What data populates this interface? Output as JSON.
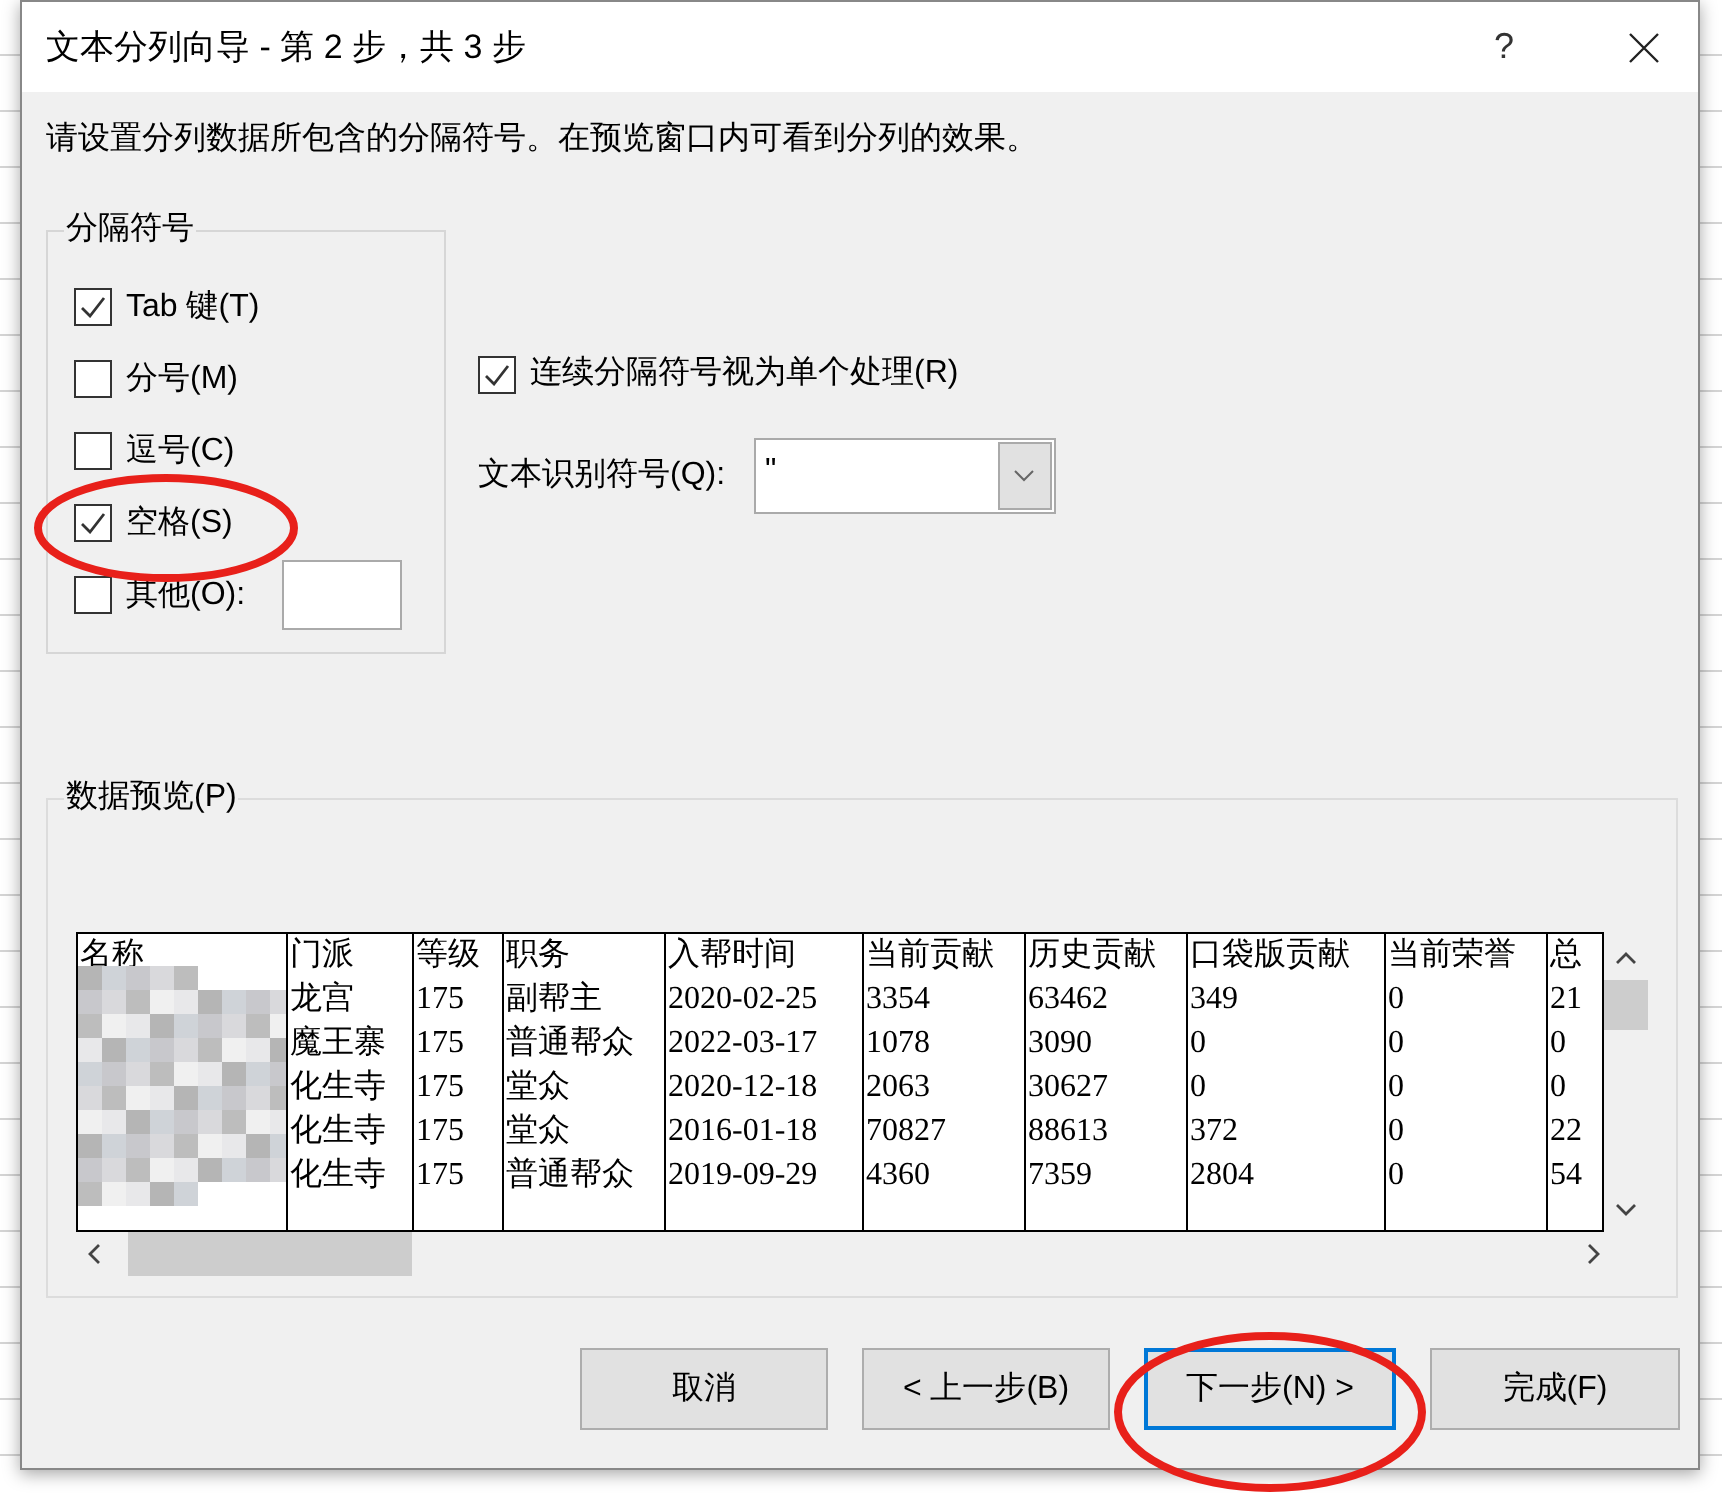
{
  "dialog": {
    "title": "文本分列向导 - 第 2 步，共 3 步",
    "help": "?",
    "instruction": "请设置分列数据所包含的分隔符号。在预览窗口内可看到分列的效果。",
    "delimiters": {
      "title": "分隔符号",
      "items": [
        {
          "label": "Tab 键(T)",
          "checked": true,
          "kind": "plain"
        },
        {
          "label": "分号(M)",
          "checked": false,
          "kind": "plain"
        },
        {
          "label": "逗号(C)",
          "checked": false,
          "kind": "plain"
        },
        {
          "label": "空格(S)",
          "checked": true,
          "kind": "plain"
        },
        {
          "label": "其他(O):",
          "checked": false,
          "kind": "other"
        }
      ]
    },
    "consecutive": {
      "label": "连续分隔符号视为单个处理(R)",
      "checked": true
    },
    "qualifier": {
      "label": "文本识别符号(Q):",
      "value": "\""
    },
    "preview": {
      "title": "数据预览(P)",
      "columns": [
        "名称",
        "门派",
        "等级",
        "职务",
        "入帮时间",
        "当前贡献",
        "历史贡献",
        "口袋版贡献",
        "当前荣誉",
        "总"
      ],
      "rows": [
        [
          "",
          "龙宫",
          "175",
          "副帮主",
          "2020-02-25",
          "3354",
          "63462",
          "349",
          "0",
          "21"
        ],
        [
          "",
          "魔王寨",
          "175",
          "普通帮众",
          "2022-03-17",
          "1078",
          "3090",
          "0",
          "0",
          "0"
        ],
        [
          "",
          "化生寺",
          "175",
          "堂众",
          "2020-12-18",
          "2063",
          "30627",
          "0",
          "0",
          "0"
        ],
        [
          "",
          "化生寺",
          "175",
          "堂众",
          "2016-01-18",
          "70827",
          "88613",
          "372",
          "0",
          "22"
        ],
        [
          "",
          "化生寺",
          "175",
          "普通帮众",
          "2019-09-29",
          "4360",
          "7359",
          "2804",
          "0",
          "54"
        ]
      ]
    },
    "buttons": [
      {
        "label": "取消",
        "focused": false
      },
      {
        "label": "< 上一步(B)",
        "focused": false
      },
      {
        "label": "下一步(N) >",
        "focused": true
      },
      {
        "label": "完成(F)",
        "focused": false
      }
    ]
  }
}
